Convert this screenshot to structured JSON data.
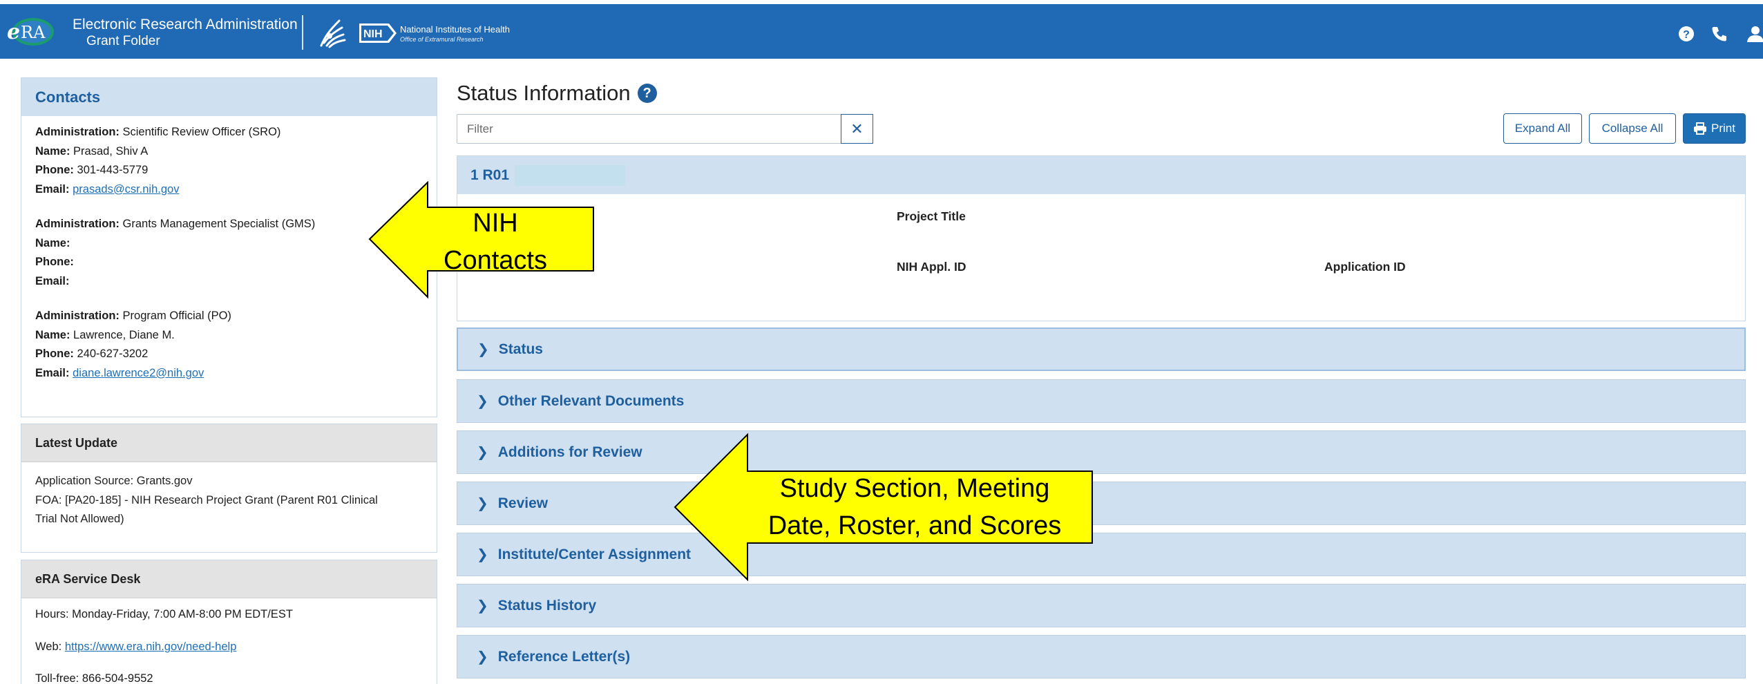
{
  "header": {
    "logo_text": "eRA",
    "app_title": "Electronic Research Administration",
    "app_subtitle": "Grant Folder",
    "nih_badge": "NIH",
    "nih_name": "National Institutes of Health",
    "nih_office": "Office of Extramural Research",
    "icons": [
      "help-icon",
      "phone-icon",
      "user-icon"
    ],
    "brand_color": "#2069b4"
  },
  "contacts": {
    "title": "Contacts",
    "blocks": [
      {
        "admin_label": "Administration:",
        "admin": "Scientific Review Officer (SRO)",
        "name_label": "Name:",
        "name": "Prasad, Shiv A",
        "phone_label": "Phone:",
        "phone": "301-443-5779",
        "email_label": "Email:",
        "email": "prasads@csr.nih.gov"
      },
      {
        "admin_label": "Administration:",
        "admin": "Grants Management Specialist (GMS)",
        "name_label": "Name:",
        "name": "",
        "phone_label": "Phone:",
        "phone": "",
        "email_label": "Email:",
        "email": ""
      },
      {
        "admin_label": "Administration:",
        "admin": "Program Official (PO)",
        "name_label": "Name:",
        "name": "Lawrence, Diane M.",
        "phone_label": "Phone:",
        "phone": "240-627-3202",
        "email_label": "Email:",
        "email": "diane.lawrence2@nih.gov"
      }
    ]
  },
  "latest_update": {
    "title": "Latest Update",
    "line1": "Application Source: Grants.gov",
    "line2": "FOA: [PA20-185] -  NIH Research Project Grant (Parent R01 Clinical",
    "line3": "Trial Not Allowed)"
  },
  "service_desk": {
    "title": "eRA Service Desk",
    "hours": "Hours: Monday-Friday, 7:00 AM-8:00 PM EDT/EST",
    "web_label": "Web:",
    "web_url": "https://www.era.nih.gov/need-help",
    "tollfree": "Toll-free: 866-504-9552"
  },
  "main": {
    "title": "Status Information",
    "help": "?",
    "filter_placeholder": "Filter",
    "clear": "✕",
    "expand_all": "Expand All",
    "collapse_all": "Collapse All",
    "print": "Print",
    "grant_id": "1 R01",
    "fields": {
      "project_title": "Project Title",
      "nih_appl_id": "NIH Appl. ID",
      "application_id": "Application ID"
    },
    "sections": [
      {
        "label": "Status",
        "active": true
      },
      {
        "label": "Other Relevant Documents"
      },
      {
        "label": "Additions for Review"
      },
      {
        "label": "Review"
      },
      {
        "label": "Institute/Center Assignment"
      },
      {
        "label": "Status History"
      },
      {
        "label": "Reference Letter(s)"
      }
    ]
  },
  "annotations": {
    "callout1_line1": "NIH",
    "callout1_line2": "Contacts",
    "callout2_line1": "Study Section, Meeting",
    "callout2_line2": "Date, Roster, and Scores",
    "fill_color": "#ffff00"
  }
}
